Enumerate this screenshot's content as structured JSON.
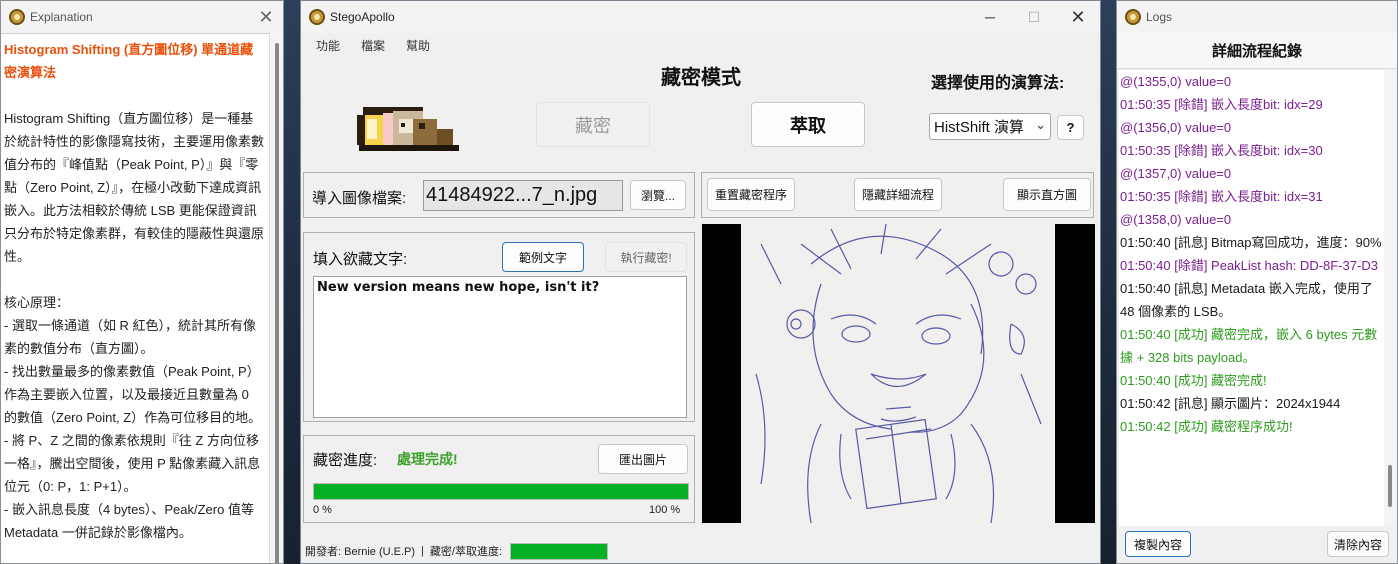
{
  "explanation": {
    "window_title": "Explanation",
    "heading": "Histogram Shifting (直方圖位移) 單通道藏密演算法",
    "intro": "Histogram Shifting（直方圖位移）是一種基於統計特性的影像隱寫技術，主要運用像素數值分布的『峰值點（Peak Point, P）』與『零點（Zero Point, Z）』，在極小改動下達成資訊嵌入。此方法相較於傳統 LSB 更能保證資訊只分布於特定像素群，有較佳的隱蔽性與還原性。",
    "principle_title": "核心原理：",
    "points": [
      "- 選取一條通道（如 R 紅色），統計其所有像素的數值分布（直方圖）。",
      "- 找出數量最多的像素數值（Peak Point, P）作為主要嵌入位置，以及最接近且數量為 0 的數值（Zero Point, Z）作為可位移目的地。",
      "- 將 P、Z 之間的像素依規則『往 Z 方向位移一格』，騰出空間後，使用 P 點像素藏入訊息位元（0: P，1: P+1）。",
      "- 嵌入訊息長度（4 bytes）、Peak/Zero 值等 Metadata 一併記錄於影像檔內。"
    ]
  },
  "main": {
    "window_title": "StegoApollo",
    "menu": [
      "功能",
      "檔案",
      "幫助"
    ],
    "mode_title": "藏密模式",
    "algo_label": "選擇使用的演算法:",
    "btn_embed": "藏密",
    "btn_extract": "萃取",
    "algo_selected": "HistShift 演算",
    "btn_help": "?",
    "file_label": "導入圖像檔案:",
    "file_value": "41484922...7_n.jpg",
    "btn_browse": "瀏覽...",
    "btn_reset": "重置藏密程序",
    "btn_hide_flow": "隱藏詳細流程",
    "btn_show_hist": "顯示直方圖",
    "text_label": "填入欲藏文字:",
    "btn_sample": "範例文字",
    "btn_run": "執行藏密!",
    "text_value": "New version means new hope, isn't it?",
    "progress_label": "藏密進度:",
    "progress_status": "處理完成!",
    "btn_export": "匯出圖片",
    "progress_min": "0 %",
    "progress_max": "100 %",
    "progress_value": 1.0,
    "status_dev": "開發者: Bernie (U.E.P)",
    "status_sep": "|",
    "status_progress_label": "藏密/萃取進度:"
  },
  "logs": {
    "window_title": "Logs",
    "title": "詳細流程紀錄",
    "entries": [
      {
        "text": "@(1355,0) value=0",
        "type": "purple"
      },
      {
        "text": "01:50:35 [除錯] 嵌入長度bit: idx=29",
        "type": "purple"
      },
      {
        "text": "@(1356,0) value=0",
        "type": "purple"
      },
      {
        "text": "01:50:35 [除錯] 嵌入長度bit: idx=30",
        "type": "purple"
      },
      {
        "text": "@(1357,0) value=0",
        "type": "purple"
      },
      {
        "text": "01:50:35 [除錯] 嵌入長度bit: idx=31",
        "type": "purple"
      },
      {
        "text": "@(1358,0) value=0",
        "type": "purple"
      },
      {
        "text": "01:50:40 [訊息] Bitmap寫回成功，進度：90%",
        "type": "black"
      },
      {
        "text": "01:50:40 [除錯] PeakList hash: DD-8F-37-D3",
        "type": "purple"
      },
      {
        "text": "01:50:40 [訊息] Metadata 嵌入完成，使用了 48 個像素的 LSB。",
        "type": "black"
      },
      {
        "text": "01:50:40 [成功] 藏密完成，嵌入 6 bytes 元數據 + 328 bits payload。",
        "type": "green"
      },
      {
        "text": "01:50:40 [成功] 藏密完成!",
        "type": "green"
      },
      {
        "text": "01:50:42 [訊息] 顯示圖片：2024x1944",
        "type": "black"
      },
      {
        "text": "01:50:42 [成功] 藏密程序成功!",
        "type": "green"
      }
    ],
    "btn_copy": "複製內容",
    "btn_clear": "清除內容"
  },
  "colors": {
    "accent_orange": "#e8510b",
    "progress_green": "#06b025",
    "log_purple": "#7a1f8f",
    "log_green": "#2e9b1e"
  }
}
